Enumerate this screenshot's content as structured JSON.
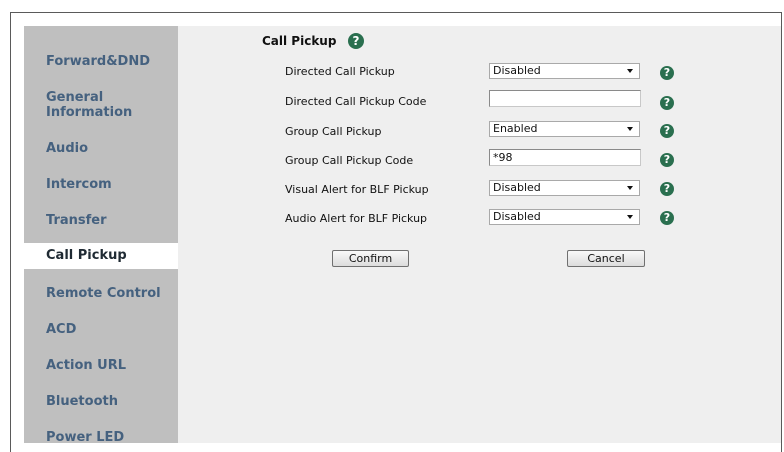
{
  "sidebar": {
    "items": [
      {
        "label": "Forward&DND"
      },
      {
        "label": "General\nInformation"
      },
      {
        "label": "Audio"
      },
      {
        "label": "Intercom"
      },
      {
        "label": "Transfer"
      },
      {
        "label": "Call Pickup"
      },
      {
        "label": "Remote Control"
      },
      {
        "label": "ACD"
      },
      {
        "label": "Action URL"
      },
      {
        "label": "Bluetooth"
      },
      {
        "label": "Power LED"
      }
    ],
    "active": "Call Pickup"
  },
  "section": {
    "title": "Call Pickup",
    "help_icon": "question-mark-icon"
  },
  "form": {
    "rows": [
      {
        "label": "Directed Call Pickup",
        "type": "select",
        "value": "Disabled"
      },
      {
        "label": "Directed Call Pickup Code",
        "type": "text",
        "value": ""
      },
      {
        "label": "Group Call Pickup",
        "type": "select",
        "value": "Enabled"
      },
      {
        "label": "Group Call Pickup Code",
        "type": "text",
        "value": "*98"
      },
      {
        "label": "Visual Alert for BLF Pickup",
        "type": "select",
        "value": "Disabled"
      },
      {
        "label": "Audio Alert for BLF Pickup",
        "type": "select",
        "value": "Disabled"
      }
    ],
    "help_glyph": "?"
  },
  "buttons": {
    "confirm": "Confirm",
    "cancel": "Cancel"
  },
  "colors": {
    "sidebar_bg": "#bfbfbf",
    "sidebar_text": "#45617f",
    "content_bg": "#efefef",
    "help_icon": "#2a6f4f"
  }
}
